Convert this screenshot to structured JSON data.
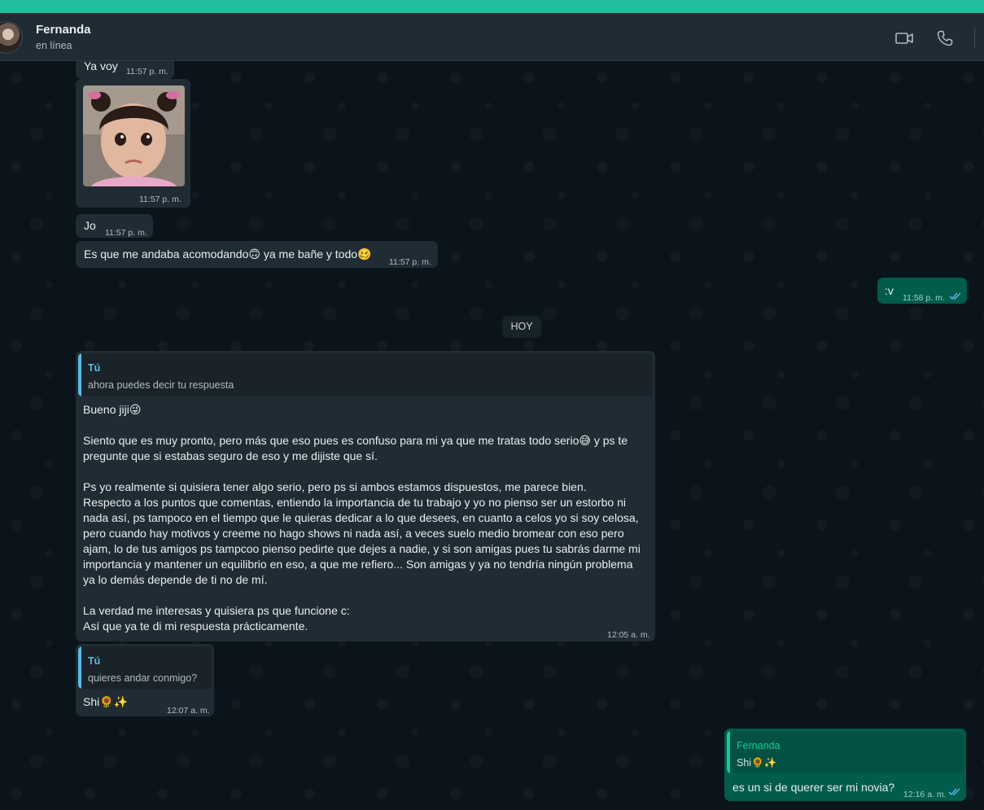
{
  "header": {
    "contact_name": "Fernanda",
    "contact_status": "en línea",
    "icons": [
      "video-call-icon",
      "voice-call-icon"
    ]
  },
  "colors": {
    "accent_strip": "#1fbf9f",
    "incoming_bubble": "#202c33",
    "outgoing_bubble": "#005c4b",
    "quote_author_in": "#53bdeb",
    "quote_author_out": "#06cf9c",
    "read_ticks": "#53bdeb"
  },
  "messages": {
    "m1": {
      "text": "Ya voy",
      "time": "11:57 p. m."
    },
    "m2": {
      "media": "photo-of-toddler",
      "time": "11:57 p. m."
    },
    "m3": {
      "text": "Jo",
      "time": "11:57 p. m."
    },
    "m4": {
      "text": "Es que me andaba acomodando🙃 ya me bañe y todo🥴",
      "time": "11:57 p. m."
    },
    "m5": {
      "text": ":v",
      "time": "11:58 p. m.",
      "status": "read"
    },
    "day_divider": "HOY",
    "m6": {
      "quote_author": "Tú",
      "quote_text": "ahora puedes decir tu respuesta",
      "paragraphs": [
        "Bueno jiji😜",
        "",
        "Siento que es muy pronto, pero más que eso pues es confuso para mi ya que me tratas todo serio😅 y ps te",
        "pregunte que si estabas seguro de eso y me dijiste que sí.",
        "",
        "Ps yo realmente si quisiera tener algo serio, pero ps si ambos estamos dispuestos, me parece bien.",
        "Respecto a los puntos que comentas, entiendo la importancia de tu trabajo y yo no pienso ser un estorbo ni",
        "nada así, ps tampoco en el tiempo que le quieras dedicar a lo que desees, en cuanto a celos yo si soy celosa,",
        "pero cuando hay motivos y creeme no hago shows ni nada así,  a veces suelo medio bromear con eso pero",
        "ajam, lo de tus amigos ps tampcoo pienso pedirte que dejes a nadie, y si son amigas pues tu sabrás darme mi",
        "importancia y mantener un equilibrio en eso, a que me refiero... Son amigas y ya no tendría ningún problema",
        "ya lo demás depende de ti no de mí.",
        "",
        "La verdad me interesas y quisiera ps que funcione c:",
        "Así que ya te di mi respuesta prácticamente."
      ],
      "time": "12:05 a. m."
    },
    "m7": {
      "quote_author": "Tú",
      "quote_text": "quieres andar conmigo?",
      "text": "Shi🌻✨",
      "time": "12:07 a. m."
    },
    "m8": {
      "quote_author": "Fernanda",
      "quote_text": "Shi🌻✨",
      "text": "es un si de querer ser mi novia?",
      "time": "12:16 a. m.",
      "status": "read"
    }
  }
}
